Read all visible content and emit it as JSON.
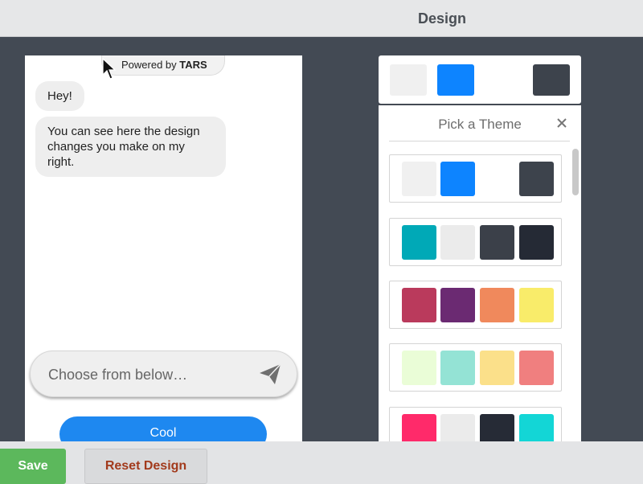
{
  "header": {
    "title": "Design"
  },
  "preview": {
    "powered_prefix": "Powered by ",
    "powered_brand": "TARS",
    "messages": [
      {
        "text": "Hey!"
      },
      {
        "text": "You can see here the design changes you make on my right."
      }
    ],
    "input_placeholder": "Choose from below…",
    "send_icon": "paper-plane-icon",
    "option_button": "Cool",
    "option_color": "#1e88f0"
  },
  "current_theme": {
    "colors": [
      "#f0f0f0",
      "#0d84ff",
      "#ffffff",
      "#3d434c"
    ]
  },
  "theme_picker": {
    "title": "Pick a Theme",
    "close_icon": "close-icon",
    "themes": [
      {
        "colors": [
          "#f0f0f0",
          "#0d84ff",
          "#ffffff",
          "#3d434c"
        ]
      },
      {
        "colors": [
          "#00a9b7",
          "#ebebeb",
          "#3b4049",
          "#252a35"
        ]
      },
      {
        "colors": [
          "#ba3a5c",
          "#6b2a72",
          "#f0895c",
          "#f9ec6a"
        ]
      },
      {
        "colors": [
          "#eafdd7",
          "#94e3d5",
          "#fbe08a",
          "#f07f7f"
        ]
      },
      {
        "colors": [
          "#ff2a6a",
          "#ebebeb",
          "#262b36",
          "#13d6d6"
        ]
      }
    ]
  },
  "footer": {
    "save_label": "Save",
    "reset_label": "Reset Design"
  }
}
